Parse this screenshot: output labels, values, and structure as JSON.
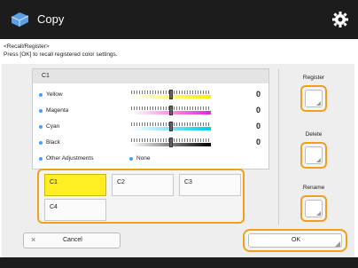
{
  "header": {
    "title": "Copy",
    "app_icon": "copy-icon",
    "settings_icon": "gear-icon"
  },
  "instructions": {
    "line1": "<Recall/Register>",
    "line2": "Press [OK] to recall registered color settings."
  },
  "content": {
    "slot_title": "C1",
    "rows": [
      {
        "label": "Yellow",
        "value": "0",
        "color": "#ffee00"
      },
      {
        "label": "Magenta",
        "value": "0",
        "color": "#ee22cc"
      },
      {
        "label": "Cyan",
        "value": "0",
        "color": "#00c8ee"
      },
      {
        "label": "Black",
        "value": "0",
        "color": "#000000"
      }
    ],
    "other_label": "Other Adjustments",
    "other_value": "None"
  },
  "slots": [
    {
      "label": "C1",
      "selected": true
    },
    {
      "label": "C2",
      "selected": false
    },
    {
      "label": "C3",
      "selected": false
    },
    {
      "label": "C4",
      "selected": false
    }
  ],
  "side": {
    "register_label": "Register",
    "delete_label": "Delete",
    "rename_label": "Rename"
  },
  "footer": {
    "cancel_label": "Cancel",
    "ok_label": "OK"
  },
  "colors": {
    "accent": "#f0a020",
    "selected": "#ffee22",
    "titlebar": "#1c1c1c"
  }
}
